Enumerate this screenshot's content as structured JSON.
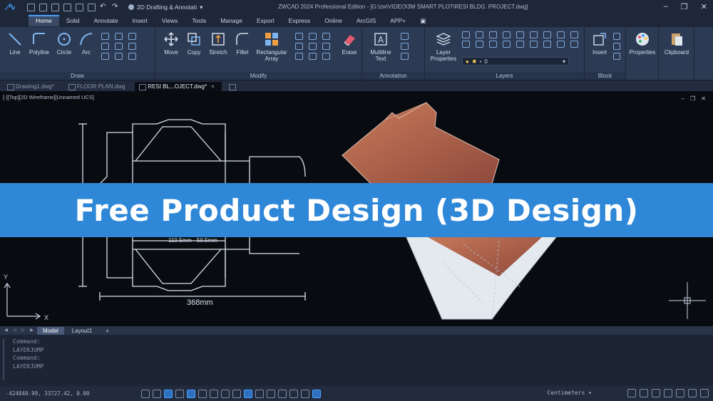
{
  "titlebar": {
    "workspace": "2D Drafting & Annotati",
    "title": "ZWCAD 2024 Professional Edition - [G:\\zw\\VIDEO\\3M SMART PLOT\\RESI BLDG. PROJECT.dwg]"
  },
  "ribbon_tabs": [
    "Home",
    "Solid",
    "Annotate",
    "Insert",
    "Views",
    "Tools",
    "Manage",
    "Export",
    "Express",
    "Online",
    "ArcGIS",
    "APP+"
  ],
  "ribbon": {
    "draw": {
      "label": "Draw",
      "tools": [
        "Line",
        "Polyline",
        "Circle",
        "Arc"
      ]
    },
    "modify": {
      "label": "Modify",
      "tools": [
        "Move",
        "Copy",
        "Stretch",
        "Fillet",
        "Rectangular Array",
        "Erase"
      ]
    },
    "annotation": {
      "label": "Annotation",
      "tools": [
        "Multiline Text"
      ]
    },
    "layers": {
      "label": "Layers",
      "tools": [
        "Layer Properties"
      ],
      "current_layer": "0"
    },
    "block": {
      "label": "Block",
      "tools": [
        "Insert"
      ]
    },
    "properties": {
      "label": "Properties"
    },
    "clipboard": {
      "label": "Clipboard"
    }
  },
  "doc_tabs": [
    {
      "label": "Drawing1.dwg*",
      "active": false
    },
    {
      "label": "FLOOR PLAN.dwg",
      "active": false
    },
    {
      "label": "RESI BL...OJECT.dwg*",
      "active": true
    }
  ],
  "viewport": {
    "label": "[-][Top][2D Wireframe][Unnamed UCS]",
    "dim_total": "368mm",
    "dim_a": "110.5mm",
    "dim_b": "50.5mm",
    "axis_x": "X",
    "axis_y": "Y"
  },
  "banner": {
    "text": "Free Product Design (3D Design)"
  },
  "layout_tabs": [
    "Model",
    "Layout1",
    "+"
  ],
  "command_lines": [
    "Command:",
    "LAYERJUMP",
    "Command:",
    "LAYERJUMP"
  ],
  "status": {
    "coords": "-424840.99, 33727.42, 0.00",
    "units": "Centimeters"
  },
  "colors": {
    "accent": "#4aa3ff",
    "banner": "#2f87d8",
    "box_orange": "#b86a4e"
  }
}
